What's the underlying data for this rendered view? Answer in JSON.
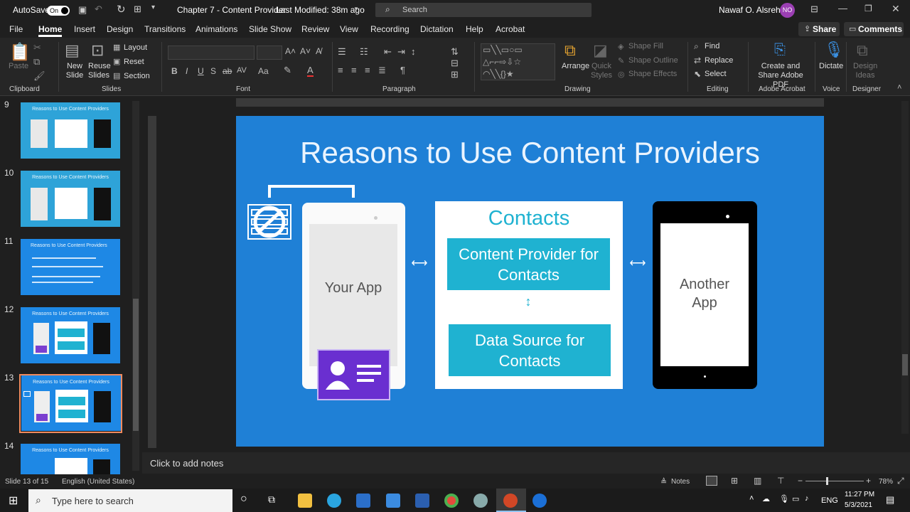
{
  "titlebar": {
    "autosave_label": "AutoSave",
    "autosave_state": "On",
    "doc_title": "Chapter 7 - Content Provider",
    "modified": "Last Modified: 38m ago",
    "search_placeholder": "Search",
    "user_name": "Nawaf O. Alsrehin",
    "user_initials": "NO"
  },
  "menu": [
    "File",
    "Home",
    "Insert",
    "Design",
    "Transitions",
    "Animations",
    "Slide Show",
    "Review",
    "View",
    "Recording",
    "Dictation",
    "Help",
    "Acrobat"
  ],
  "share_label": "Share",
  "comments_label": "Comments",
  "ribbon": {
    "paste": "Paste",
    "new_slide": "New Slide",
    "reuse_slides": "Reuse Slides",
    "layout": "Layout",
    "reset": "Reset",
    "section": "Section",
    "arrange": "Arrange",
    "quick_styles": "Quick Styles",
    "shape_fill": "Shape Fill",
    "shape_outline": "Shape Outline",
    "shape_effects": "Shape Effects",
    "find": "Find",
    "replace": "Replace",
    "select": "Select",
    "create_share_pdf": "Create and Share Adobe PDF",
    "dictate": "Dictate",
    "design_ideas": "Design Ideas",
    "groups": [
      "Clipboard",
      "Slides",
      "Font",
      "Paragraph",
      "Drawing",
      "Editing",
      "Adobe Acrobat",
      "Voice",
      "Designer"
    ]
  },
  "thumbnails": [
    {
      "num": "9",
      "title": "Reasons to Use Content Providers",
      "style": "cyan"
    },
    {
      "num": "10",
      "title": "Reasons to Use Content Providers",
      "style": "cyan"
    },
    {
      "num": "11",
      "title": "Reasons to Use Content Providers",
      "style": "blue"
    },
    {
      "num": "12",
      "title": "Reasons to Use Content Providers",
      "style": "blue"
    },
    {
      "num": "13",
      "title": "Reasons to Use Content Providers",
      "style": "blue"
    },
    {
      "num": "14",
      "title": "Reasons to Use Content Providers",
      "style": "blue"
    }
  ],
  "slide": {
    "title": "Reasons to Use Content Providers",
    "your_app": "Your App",
    "contacts": "Contacts",
    "content_provider": "Content Provider for Contacts",
    "data_source": "Data Source for Contacts",
    "another_app": "Another App"
  },
  "notes_placeholder": "Click to add notes",
  "status": {
    "slide_info": "Slide 13 of 15",
    "language": "English (United States)",
    "notes": "Notes",
    "zoom": "78%"
  },
  "taskbar": {
    "search_placeholder": "Type here to search",
    "lang": "ENG",
    "time": "11:27 PM",
    "date": "5/3/2021"
  },
  "colors": {
    "slide_bg": "#1f80d6",
    "thumb_cyan": "#2ea3d8",
    "accent_teal": "#1fb2d1",
    "selection": "#f08a5d",
    "user_avatar": "#9b3fb3"
  }
}
